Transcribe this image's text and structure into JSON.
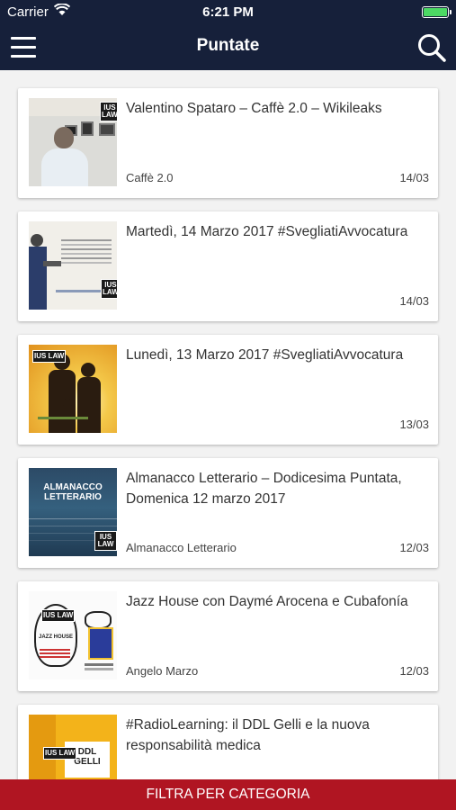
{
  "status_bar": {
    "carrier": "Carrier",
    "time": "6:21 PM",
    "battery_level": 1.0
  },
  "navbar": {
    "title": "Puntate",
    "menu_icon": "hamburger-menu-icon",
    "search_icon": "search-icon"
  },
  "episodes": [
    {
      "title": "Valentino Spataro – Caffè 2.0 – Wikileaks",
      "category": "Caffè 2.0",
      "date": "14/03"
    },
    {
      "title": "Martedì, 14 Marzo 2017 #SvegliatiAvvocatura",
      "category": "",
      "date": "14/03"
    },
    {
      "title": "Lunedì, 13 Marzo 2017 #SvegliatiAvvocatura",
      "category": "",
      "date": "13/03"
    },
    {
      "title": "Almanacco Letterario – Dodicesima Puntata, Domenica 12 marzo 2017",
      "category": "Almanacco Letterario",
      "date": "12/03",
      "thumb_text": "ALMANACCO LETTERARIO"
    },
    {
      "title": "Jazz House con Daymé Arocena e Cubafonía",
      "category": "Angelo Marzo",
      "date": "12/03",
      "thumb_text": "JAZZ HOUSE"
    },
    {
      "title": "#RadioLearning: il DDL Gelli e la nuova responsabilità medica",
      "category": "",
      "date": "",
      "thumb_text": "DDL GELLI"
    }
  ],
  "logo_text": "IUS LAW",
  "filter_button": {
    "label": "FILTRA PER CATEGORIA"
  },
  "colors": {
    "header": "#16203a",
    "filter_bar": "#b01522",
    "battery": "#4cd964"
  }
}
